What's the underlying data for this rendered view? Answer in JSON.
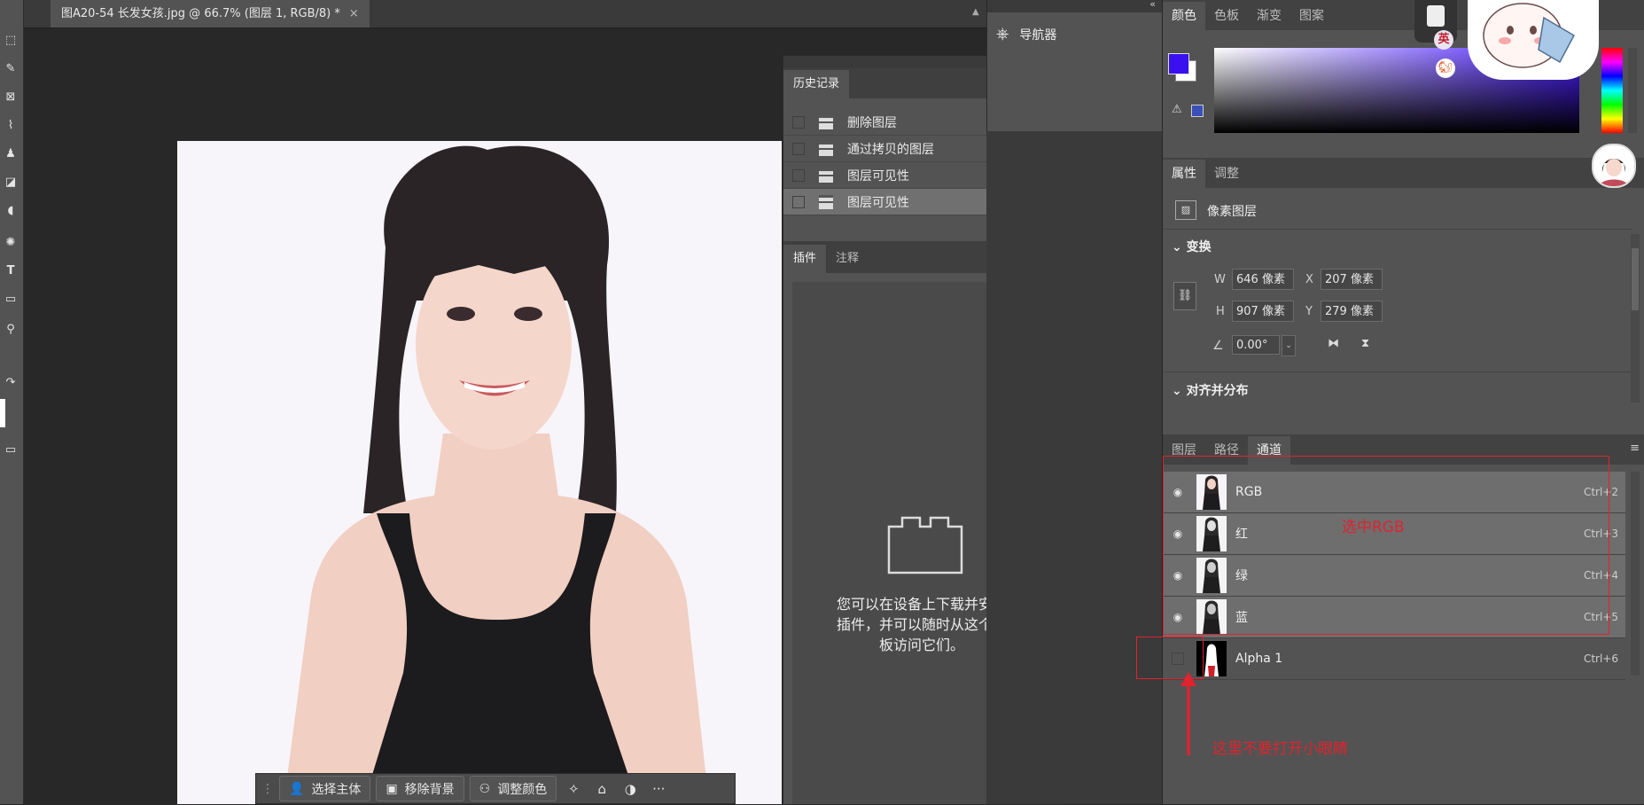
{
  "document": {
    "tab_title": "图A20-54 长发女孩.jpg @ 66.7% (图层 1, RGB/8) *",
    "close_glyph": "×"
  },
  "history": {
    "tab": "历史记录",
    "items": [
      {
        "label": "删除图层"
      },
      {
        "label": "通过拷贝的图层"
      },
      {
        "label": "图层可见性"
      },
      {
        "label": "图层可见性"
      }
    ]
  },
  "plugins": {
    "tabs": [
      "插件",
      "注释"
    ],
    "message_lines": [
      "您可以在设备上下载并安装",
      "插件，并可以随时从这个面",
      "板访问它们。"
    ]
  },
  "navigator": {
    "label": "导航器"
  },
  "color_panel": {
    "tabs": [
      "颜色",
      "色板",
      "渐变",
      "图案"
    ],
    "foreground": "#3a10f0",
    "background": "#ffffff"
  },
  "properties": {
    "tabs": [
      "属性",
      "调整"
    ],
    "layer_type": "像素图层",
    "transform_title": "变换",
    "w_label": "W",
    "w_value": "646 像素",
    "x_label": "X",
    "x_value": "207 像素",
    "h_label": "H",
    "h_value": "907 像素",
    "y_label": "Y",
    "y_value": "279 像素",
    "angle_value": "0.00°",
    "align_title": "对齐并分布"
  },
  "channels": {
    "tabs": [
      "图层",
      "路径",
      "通道"
    ],
    "rows": [
      {
        "name": "RGB",
        "shortcut": "Ctrl+2"
      },
      {
        "name": "红",
        "shortcut": "Ctrl+3"
      },
      {
        "name": "绿",
        "shortcut": "Ctrl+4"
      },
      {
        "name": "蓝",
        "shortcut": "Ctrl+5"
      },
      {
        "name": "Alpha 1",
        "shortcut": "Ctrl+6"
      }
    ]
  },
  "annotations": {
    "select_rgb": "选中RGB",
    "no_eye": "这里不要打开小眼睛"
  },
  "context_bar": {
    "select_subject": "选择主体",
    "remove_bg": "移除背景",
    "adjust_color": "调整颜色",
    "more": "···"
  },
  "ime": {
    "label": "英"
  }
}
